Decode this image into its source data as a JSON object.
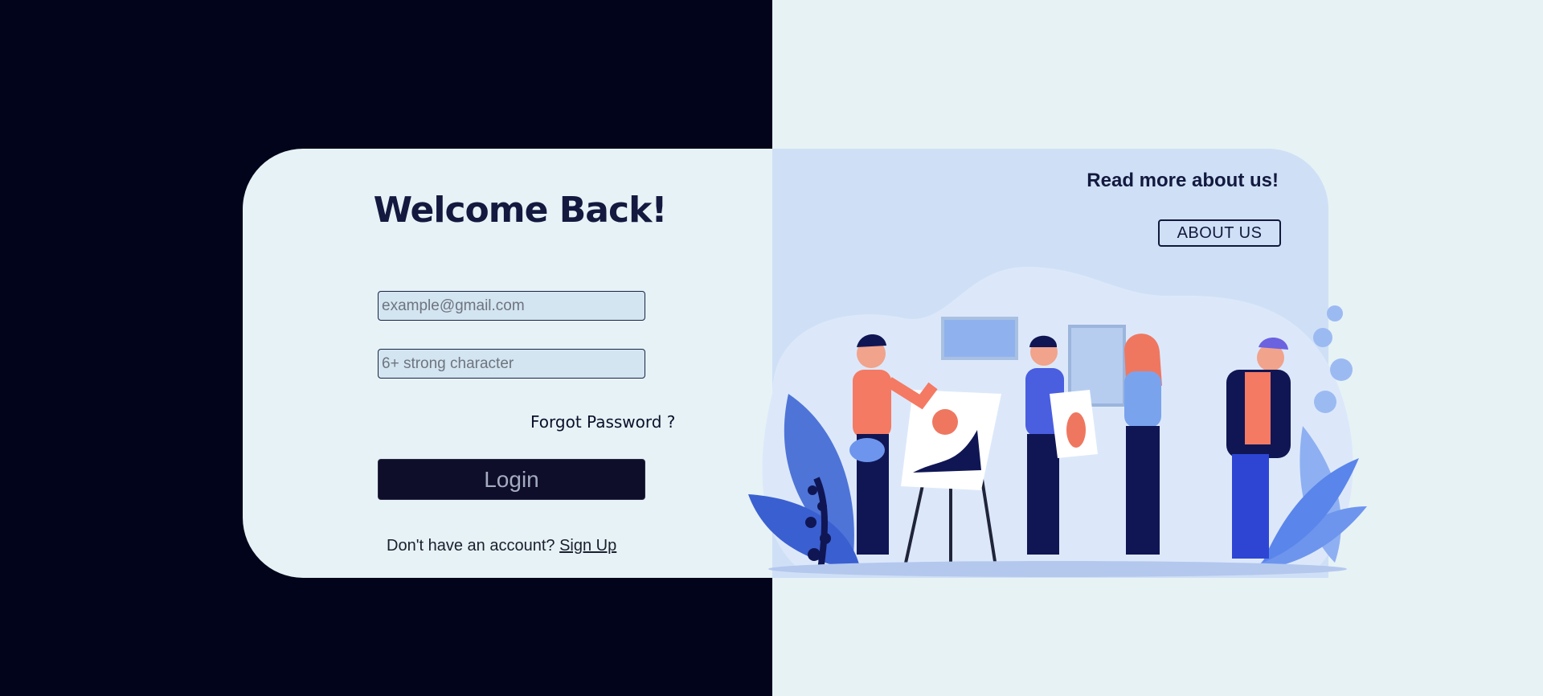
{
  "login": {
    "title": "Welcome Back!",
    "email_placeholder": "example@gmail.com",
    "password_placeholder": "6+ strong character",
    "forgot_label": "Forgot Password ?",
    "login_label": "Login",
    "signup_prompt": "Don't have an account?",
    "signup_link": "Sign Up"
  },
  "about": {
    "heading": "Read more about us!",
    "button_label": "ABOUT US"
  },
  "illustration": {
    "icon": "people-painting-gallery-illustration"
  },
  "colors": {
    "left_background": "#01041a",
    "right_background": "#e7f2f5",
    "card": "#e6f2f5",
    "accent_panel": "#cfe0f6",
    "login_button": "#0e0e2a",
    "text_dark": "#13193f"
  }
}
